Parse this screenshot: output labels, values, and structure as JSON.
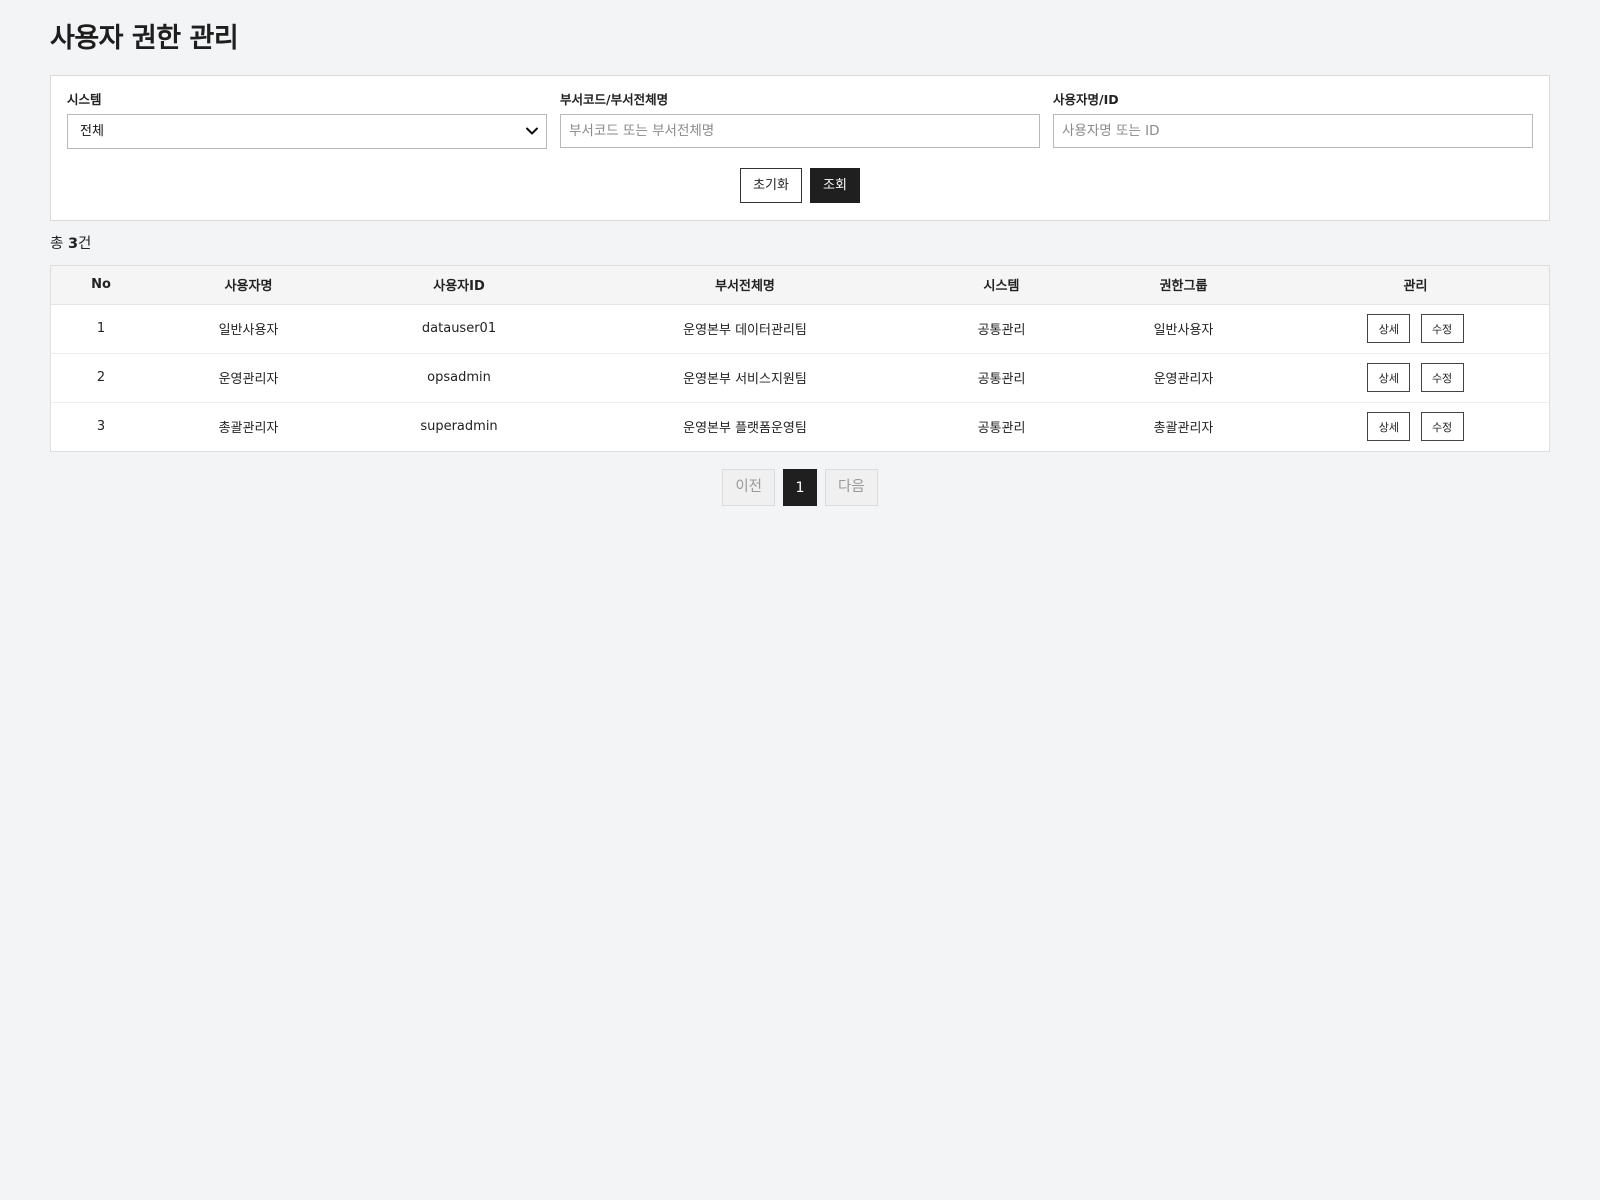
{
  "page": {
    "title": "사용자 권한 관리"
  },
  "filters": {
    "system": {
      "label": "시스템",
      "selected": "전체"
    },
    "dept": {
      "label": "부서코드/부서전체명",
      "placeholder": "부서코드 또는 부서전체명",
      "value": ""
    },
    "user": {
      "label": "사용자명/ID",
      "placeholder": "사용자명 또는 ID",
      "value": ""
    },
    "reset_label": "초기화",
    "search_label": "조회"
  },
  "summary": {
    "prefix": "총 ",
    "count": "3",
    "suffix": "건"
  },
  "table": {
    "columns": [
      "No",
      "사용자명",
      "사용자ID",
      "부서전체명",
      "시스템",
      "권한그룹",
      "관리"
    ],
    "rows": [
      {
        "no": "1",
        "name": "일반사용자",
        "id": "datauser01",
        "dept": "운영본부 데이터관리팀",
        "system": "공통관리",
        "group": "일반사용자"
      },
      {
        "no": "2",
        "name": "운영관리자",
        "id": "opsadmin",
        "dept": "운영본부 서비스지원팀",
        "system": "공통관리",
        "group": "운영관리자"
      },
      {
        "no": "3",
        "name": "총괄관리자",
        "id": "superadmin",
        "dept": "운영본부 플랫폼운영팀",
        "system": "공통관리",
        "group": "총괄관리자"
      }
    ],
    "detail_label": "상세",
    "edit_label": "수정"
  },
  "pagination": {
    "prev_label": "이전",
    "current_page": "1",
    "next_label": "다음"
  },
  "icons": {
    "select_chevron": "chevron-down-icon"
  },
  "colors": {
    "background": "#f3f4f6",
    "primary_button": "#1f1f1f",
    "panel": "#ffffff"
  }
}
